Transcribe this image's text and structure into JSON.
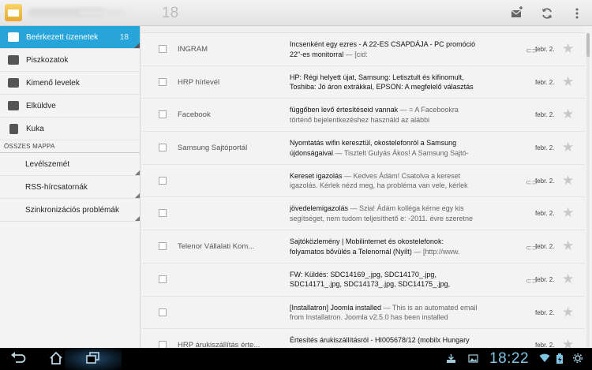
{
  "header": {
    "unread_count": "18",
    "icons": [
      "compose-icon",
      "refresh-icon",
      "overflow-menu-icon"
    ]
  },
  "sidebar": {
    "folders": [
      {
        "label": "Beérkezett üzenetek",
        "count": "18",
        "icon": "inbox-icon",
        "active": true
      },
      {
        "label": "Piszkozatok",
        "icon": "drafts-icon"
      },
      {
        "label": "Kimenő levelek",
        "icon": "outbox-icon"
      },
      {
        "label": "Elküldve",
        "icon": "sent-icon"
      },
      {
        "label": "Kuka",
        "icon": "trash-icon"
      }
    ],
    "section_title": "ÖSSZES MAPPA",
    "all_folders": [
      {
        "label": "Levélszemét"
      },
      {
        "label": "RSS-hírcsatornák"
      },
      {
        "label": "Szinkronizációs problémák"
      }
    ]
  },
  "messages": [
    {
      "sender": "INGRAM",
      "subject": "Incsenként egy ezres - A 22-ES CSAPDÁJA - PC promóció 22\"-es monitorral",
      "snippet": " — [cid:",
      "attachment": true,
      "date": "febr. 2."
    },
    {
      "sender": "HRP hírlevél",
      "subject": "HP: Régi helyett újat, Samsung: Letisztult és kifinomult, Toshiba: Jó áron extrákkal, EPSON: A megfelelő választás",
      "snippet": "",
      "attachment": false,
      "date": "febr. 2."
    },
    {
      "sender": "Facebook",
      "subject": "             függőben levő értesítéseid vannak",
      "snippet": " — = A Facebookra történő bejelentkezéshez használd az alábbi",
      "attachment": false,
      "date": "febr. 2."
    },
    {
      "sender": "Samsung Sajtóportál",
      "subject": "Nyomtatás wifin keresztül, okostelefonról  a Samsung újdonságaival",
      "snippet": " — Tisztelt Gulyás Ákos! A Samsung Sajtó-",
      "attachment": false,
      "date": "febr. 2."
    },
    {
      "sender": "",
      "subject": "Kereset igazolás",
      "snippet": " — Kedves Ádám! Csatolva a kereset igazolás. Kérlek nézd meg, ha probléma van vele, kérlek",
      "attachment": true,
      "date": "febr. 2."
    },
    {
      "sender": "",
      "subject": "jövedelemigazolás",
      "snippet": " — Szia! Ádám kolléga kérne egy kis segítséget, nem tudom teljesíthető e: -2011. évre szeretne",
      "attachment": false,
      "date": "febr. 2."
    },
    {
      "sender": "Telenor Vállalati Kom...",
      "subject": "Sajtóközlemény | Mobilinternet és okostelefonok: folyamatos bővülés a Telenornál (Nyílt)",
      "snippet": " — [http://www.",
      "attachment": true,
      "date": "febr. 2."
    },
    {
      "sender": "",
      "subject": "FW: Küldés: SDC14169_.jpg, SDC14170_.jpg, SDC14171_.jpg, SDC14173_.jpg, SDC14175_.jpg, SDC14176_.jpg,",
      "snippet": "",
      "attachment": true,
      "date": "febr. 2."
    },
    {
      "sender": "",
      "subject": "[Installatron] Joomla installed",
      "snippet": " — This is an automated email from Installatron. Joomla v2.5.0 has been installed",
      "attachment": false,
      "date": "febr. 2."
    },
    {
      "sender": "HRP árukiszállítás érte...",
      "subject": "Értesítés árukiszállításról - HI005678/12 (mobilx Hungary",
      "snippet": "",
      "attachment": false,
      "date": "febr. 2."
    }
  ],
  "system_bar": {
    "time": "18:22",
    "icons": [
      "back-icon",
      "home-icon",
      "recent-apps-icon",
      "download-icon",
      "gallery-icon",
      "wifi-icon",
      "battery-icon"
    ]
  },
  "colors": {
    "accent": "#27a5db",
    "clock": "#7ec4e3"
  }
}
